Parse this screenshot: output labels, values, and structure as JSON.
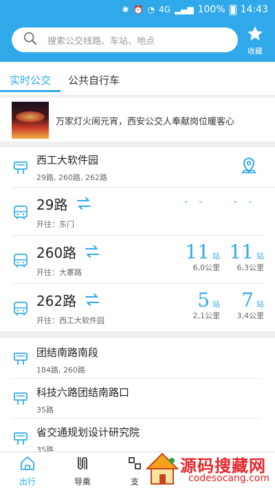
{
  "status_bar": {
    "battery": "100%",
    "time": "14:43",
    "network": "4G"
  },
  "search": {
    "placeholder": "搜索公交线路、车站、地点"
  },
  "favorites": {
    "label": "收藏"
  },
  "tabs": [
    {
      "label": "实时公交",
      "active": true
    },
    {
      "label": "公共自行车",
      "active": false
    }
  ],
  "news": {
    "text": "万家灯火闹元宵，西安公交人奉献岗位暖客心"
  },
  "nearby": [
    {
      "stop_name": "西工大软件园",
      "stop_routes": "29路, 260路, 262路",
      "routes": [
        {
          "name": "29路",
          "dest": "开往：东门",
          "arrivals": [
            {
              "placeholder": "- -"
            },
            {
              "placeholder": "- -"
            }
          ]
        },
        {
          "name": "260路",
          "dest": "开往：大寨路",
          "arrivals": [
            {
              "stops": "11",
              "unit": "站",
              "distance": "6,0公里"
            },
            {
              "stops": "11",
              "unit": "站",
              "distance": "6,3公里"
            }
          ]
        },
        {
          "name": "262路",
          "dest": "开往：西工大软件园",
          "arrivals": [
            {
              "stops": "5",
              "unit": "站",
              "distance": "2,1公里"
            },
            {
              "stops": "7",
              "unit": "站",
              "distance": "3,4公里"
            }
          ]
        }
      ]
    },
    {
      "stop_name": "团结南路南段",
      "stop_routes": "184路, 260路"
    },
    {
      "stop_name": "科技六路团结南路口",
      "stop_routes": "35路"
    },
    {
      "stop_name": "省交通规划设计研究院",
      "stop_routes": "35路"
    }
  ],
  "bottom_nav": [
    {
      "label": "出行",
      "active": true,
      "icon": "home-icon"
    },
    {
      "label": "导乘",
      "active": false,
      "icon": "route-guide-icon"
    },
    {
      "label": "支",
      "active": false,
      "icon": "pay-icon"
    }
  ],
  "watermark": {
    "text": "源码搜藏网",
    "url": "codesocang.com"
  },
  "colors": {
    "accent": "#2fa9ea",
    "watermark": "#e8262b"
  }
}
